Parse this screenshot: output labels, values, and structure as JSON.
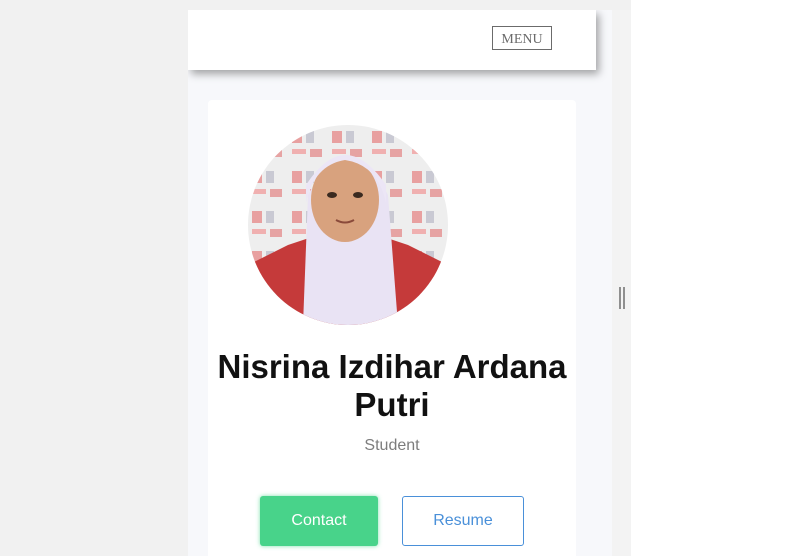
{
  "navbar": {
    "menu_label": "MENU"
  },
  "profile": {
    "name": "Nisrina Izdihar Ardana Putri",
    "role": "Student",
    "photo_icon": "profile-photo"
  },
  "actions": {
    "contact_label": "Contact",
    "resume_label": "Resume"
  },
  "colors": {
    "contact_bg": "#48d38a",
    "resume_accent": "#4a90d9",
    "page_bg": "#f7f8fb"
  }
}
